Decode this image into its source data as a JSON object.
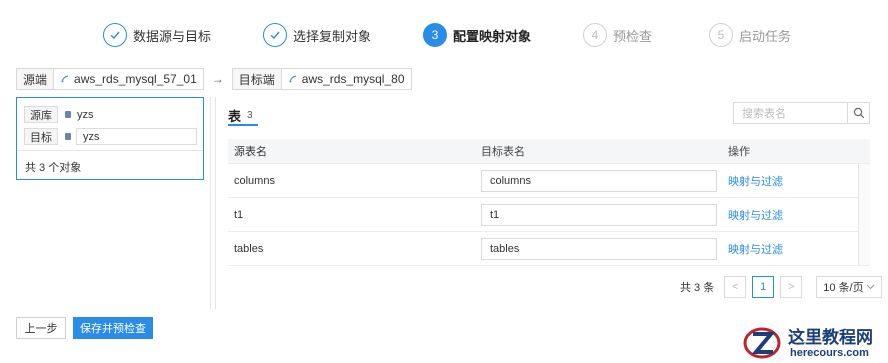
{
  "steps": [
    {
      "label": "数据源与目标",
      "state": "done",
      "num": "1"
    },
    {
      "label": "选择复制对象",
      "state": "done",
      "num": "2"
    },
    {
      "label": "配置映射对象",
      "state": "active",
      "num": "3"
    },
    {
      "label": "预检查",
      "state": "pending",
      "num": "4"
    },
    {
      "label": "启动任务",
      "state": "pending",
      "num": "5"
    }
  ],
  "endpoints": {
    "source_tag": "源端",
    "source_value": "aws_rds_mysql_57_01",
    "target_tag": "目标端",
    "target_value": "aws_rds_mysql_80"
  },
  "left_panel": {
    "source_label": "源库",
    "source_value": "yzs",
    "target_label": "目标",
    "target_value": "yzs",
    "footer": "共 3 个对象"
  },
  "tab": {
    "label": "表",
    "count": "3"
  },
  "search": {
    "placeholder": "搜索表名"
  },
  "table": {
    "headers": {
      "source": "源表名",
      "target": "目标表名",
      "action": "操作"
    },
    "rows": [
      {
        "source": "columns",
        "target": "columns",
        "action": "映射与过滤"
      },
      {
        "source": "t1",
        "target": "t1",
        "action": "映射与过滤"
      },
      {
        "source": "tables",
        "target": "tables",
        "action": "映射与过滤"
      }
    ]
  },
  "pager": {
    "total": "共 3 条",
    "prev": "<",
    "current": "1",
    "next": ">",
    "page_size": "10 条/页"
  },
  "buttons": {
    "prev": "上一步",
    "save": "保存并预检查"
  },
  "watermark": {
    "title": "这里教程网",
    "subtitle": "herecours.com"
  },
  "colors": {
    "accent": "#2a8ce8",
    "brand": "#1a3f7a"
  }
}
